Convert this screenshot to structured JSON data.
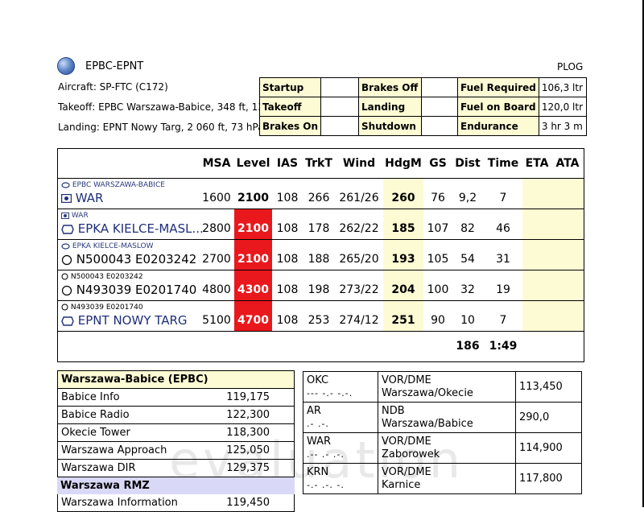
{
  "header": {
    "route": "EPBC-EPNT",
    "doc_type": "PLOG",
    "aircraft": "Aircraft:  SP-FTC (C172)",
    "takeoff": "Takeoff:  EPBC Warszawa-Babice, 348 ft, 13",
    "landing": "Landing:  EPNT Nowy Targ, 2 060 ft, 73 hPa"
  },
  "status": {
    "startup": "Startup",
    "takeoff": "Takeoff",
    "brakes_on": "Brakes On",
    "brakes_off": "Brakes Off",
    "landing": "Landing",
    "shutdown": "Shutdown",
    "fuel_required": "Fuel Required",
    "fuel_required_val": "106,3 ltr",
    "fuel_on_board": "Fuel on Board",
    "fuel_on_board_val": "120,0 ltr",
    "endurance": "Endurance",
    "endurance_val": "3 hr 3 m"
  },
  "navlog": {
    "headers": {
      "msa": "MSA",
      "level": "Level",
      "ias": "IAS",
      "trkt": "TrkT",
      "wind": "Wind",
      "hdgm": "HdgM",
      "gs": "GS",
      "dist": "Dist",
      "time": "Time",
      "eta": "ETA",
      "ata": "ATA"
    },
    "rows": [
      {
        "from": "EPBC WARSZAWA-BABICE",
        "to": "WAR",
        "msa": "1600",
        "level": "2100",
        "ias": "108",
        "trkt": "266",
        "wind": "261/26",
        "hdgm": "260",
        "gs": "76",
        "dist": "9,2",
        "time": "7"
      },
      {
        "from": "WAR",
        "to": "EPKA KIELCE-MASL...",
        "msa": "2800",
        "level": "2100",
        "ias": "108",
        "trkt": "178",
        "wind": "262/22",
        "hdgm": "185",
        "gs": "107",
        "dist": "82",
        "time": "46"
      },
      {
        "from": "EPKA KIELCE-MASLOW",
        "to": "N500043 E0203242",
        "msa": "2700",
        "level": "2100",
        "ias": "108",
        "trkt": "188",
        "wind": "265/20",
        "hdgm": "193",
        "gs": "105",
        "dist": "54",
        "time": "31"
      },
      {
        "from": "N500043 E0203242",
        "to": "N493039 E0201740",
        "msa": "4800",
        "level": "4300",
        "ias": "108",
        "trkt": "198",
        "wind": "273/22",
        "hdgm": "204",
        "gs": "100",
        "dist": "32",
        "time": "19"
      },
      {
        "from": "N493039 E0201740",
        "to": "EPNT NOWY TARG",
        "msa": "5100",
        "level": "4700",
        "ias": "108",
        "trkt": "253",
        "wind": "274/12",
        "hdgm": "251",
        "gs": "90",
        "dist": "10",
        "time": "7"
      }
    ],
    "total_dist": "186",
    "total_time": "1:49"
  },
  "frequencies": {
    "group1": "Warszawa-Babice (EPBC)",
    "items1": [
      {
        "name": "Babice Info",
        "freq": "119,175"
      },
      {
        "name": "Babice Radio",
        "freq": "122,300"
      },
      {
        "name": "Okecie Tower",
        "freq": "118,300"
      },
      {
        "name": "Warszawa Approach",
        "freq": "125,050"
      },
      {
        "name": "Warszawa DIR",
        "freq": "129,375"
      }
    ],
    "group2": "Warszawa RMZ",
    "items2": [
      {
        "name": "Warszawa Information",
        "freq": "119,450"
      }
    ]
  },
  "navaids": [
    {
      "id": "OKC",
      "morse": "--- -.- -.-.",
      "type": "VOR/DME",
      "name": "Warszawa/Okecie",
      "freq": "113,450"
    },
    {
      "id": "AR",
      "morse": ".- .-.",
      "type": "NDB",
      "name": "Warszawa/Babice",
      "freq": "290,0"
    },
    {
      "id": "WAR",
      "morse": ".-- .- .-.",
      "type": "VOR/DME",
      "name": "Zaborowek",
      "freq": "114,900"
    },
    {
      "id": "KRN",
      "morse": "-.- .-. -.",
      "type": "VOR/DME",
      "name": "Karnice",
      "freq": "117,800"
    }
  ],
  "watermark": "evaluation",
  "icons": {
    "globe": "globe-icon",
    "airport": "airport-icon",
    "vor": "vor-icon",
    "waypoint": "waypoint-circle-icon"
  }
}
